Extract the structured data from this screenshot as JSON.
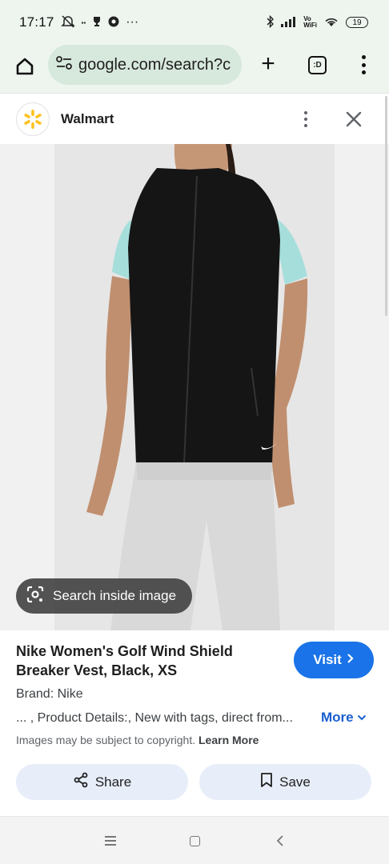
{
  "status_bar": {
    "time": "17:17",
    "left_icons": [
      "muted-alarm-icon",
      "app-notification-icon",
      "trophy-icon",
      "chrome-icon"
    ],
    "overflow": "···",
    "right_icons": [
      "bluetooth-icon",
      "signal-icon",
      "vowifi-icon",
      "wifi-icon"
    ],
    "vowifi_top": "Vo",
    "vowifi_bottom": "WiFi",
    "battery": "19"
  },
  "browser": {
    "url": "google.com/search?c",
    "tab_count": ":D",
    "icons": [
      "home-icon",
      "site-info-icon",
      "plus-icon",
      "tabs-icon",
      "menu-icon"
    ]
  },
  "source": {
    "name": "Walmart",
    "logo_color": "#ffc220",
    "icons": [
      "walmart-spark-icon",
      "more-vert-icon",
      "close-icon"
    ]
  },
  "image": {
    "search_inside_label": "Search inside image",
    "icon": "lens-icon"
  },
  "product": {
    "title": "Nike Women's Golf Wind Shield Breaker Vest, Black, XS",
    "visit_label": "Visit",
    "brand": "Brand: Nike",
    "description": "... , Product Details:, New with tags, direct from...",
    "more_label": "More",
    "copyright_text": "Images may be subject to copyright.",
    "learn_more_label": "Learn More",
    "share_label": "Share",
    "save_label": "Save",
    "accent_color": "#1a73e8"
  },
  "nav_bar": {
    "icons": [
      "recents-icon",
      "home-nav-icon",
      "back-icon"
    ]
  }
}
